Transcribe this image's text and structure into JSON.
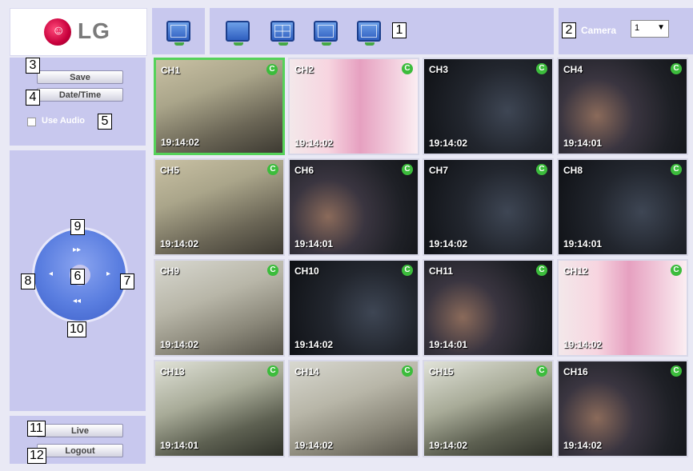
{
  "brand": {
    "logo_text": "LG",
    "logo_face": "☺",
    "accent": "#c8003c"
  },
  "toolbar": {
    "camera_label": "Camera",
    "camera_value": "1",
    "camera_arrow": "▼"
  },
  "controls": {
    "save_label": "Save",
    "datetime_label": "Date/Time",
    "use_audio_label": "Use Audio",
    "live_label": "Live",
    "logout_label": "Logout"
  },
  "ptz": {
    "up": "▸▸",
    "down": "◂◂",
    "left": "◂",
    "right": "▸"
  },
  "callouts": [
    "1",
    "2",
    "3",
    "4",
    "5",
    "6",
    "7",
    "8",
    "9",
    "10",
    "11",
    "12"
  ],
  "channels": [
    {
      "label": "CH1",
      "time": "19:14:02",
      "status": "C"
    },
    {
      "label": "CH2",
      "time": "19:14:02",
      "status": "C"
    },
    {
      "label": "CH3",
      "time": "19:14:02",
      "status": "C"
    },
    {
      "label": "CH4",
      "time": "19:14:01",
      "status": "C"
    },
    {
      "label": "CH5",
      "time": "19:14:02",
      "status": "C"
    },
    {
      "label": "CH6",
      "time": "19:14:01",
      "status": "C"
    },
    {
      "label": "CH7",
      "time": "19:14:02",
      "status": "C"
    },
    {
      "label": "CH8",
      "time": "19:14:01",
      "status": "C"
    },
    {
      "label": "CH9",
      "time": "19:14:02",
      "status": "C"
    },
    {
      "label": "CH10",
      "time": "19:14:02",
      "status": "C"
    },
    {
      "label": "CH11",
      "time": "19:14:01",
      "status": "C"
    },
    {
      "label": "CH12",
      "time": "19:14:02",
      "status": "C"
    },
    {
      "label": "CH13",
      "time": "19:14:01",
      "status": "C"
    },
    {
      "label": "CH14",
      "time": "19:14:02",
      "status": "C"
    },
    {
      "label": "CH15",
      "time": "19:14:02",
      "status": "C"
    },
    {
      "label": "CH16",
      "time": "19:14:02",
      "status": "C"
    }
  ]
}
